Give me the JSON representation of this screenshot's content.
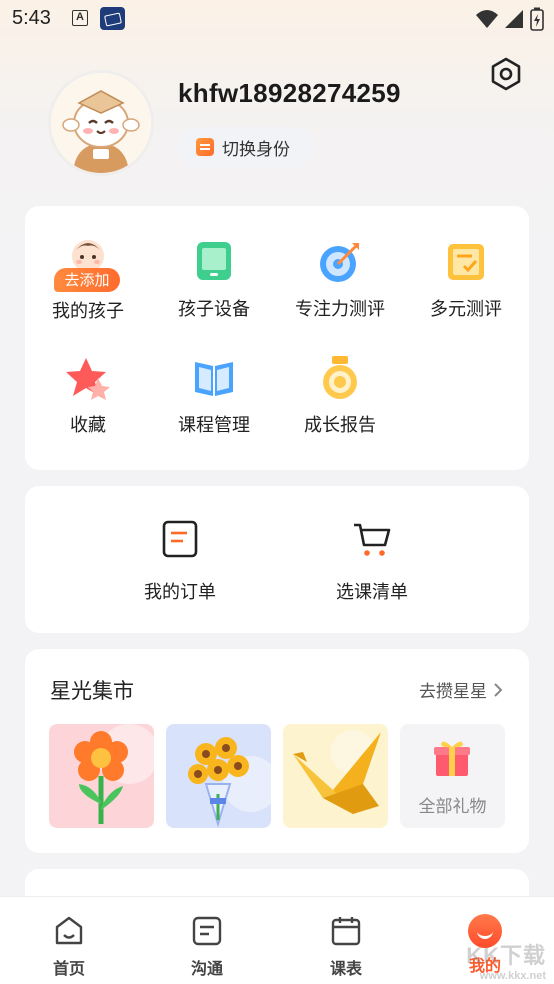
{
  "status_bar": {
    "time": "5:43"
  },
  "profile": {
    "username": "khfw18928274259",
    "switch_label": "切换身份"
  },
  "features": [
    {
      "label": "我的孩子",
      "icon": "baby-icon",
      "badge": "去添加"
    },
    {
      "label": "孩子设备",
      "icon": "tablet-icon"
    },
    {
      "label": "专注力测评",
      "icon": "target-icon"
    },
    {
      "label": "多元测评",
      "icon": "clipboard-icon"
    },
    {
      "label": "收藏",
      "icon": "star-icon"
    },
    {
      "label": "课程管理",
      "icon": "book-icon"
    },
    {
      "label": "成长报告",
      "icon": "medal-icon"
    }
  ],
  "orders": [
    {
      "label": "我的订单",
      "icon": "order-icon"
    },
    {
      "label": "选课清单",
      "icon": "cart-icon"
    }
  ],
  "market": {
    "title": "星光集市",
    "link": "去攒星星",
    "gifts": [
      {
        "name": "flower-gift",
        "bg": "#fdd5d8"
      },
      {
        "name": "bouquet-gift",
        "bg": "#d9e2fb"
      },
      {
        "name": "paper-crane-gift",
        "bg": "#fdf3cf"
      }
    ],
    "all_label": "全部礼物"
  },
  "tabs": [
    {
      "label": "首页",
      "icon": "home-icon"
    },
    {
      "label": "沟通",
      "icon": "chat-icon"
    },
    {
      "label": "课表",
      "icon": "calendar-icon"
    },
    {
      "label": "我的",
      "icon": "profile-icon",
      "active": true
    }
  ],
  "colors": {
    "accent": "#ff5a2b",
    "orange_badge": "#ff7a35"
  },
  "watermark": {
    "main": "KK下载",
    "sub": "www.kkx.net"
  }
}
